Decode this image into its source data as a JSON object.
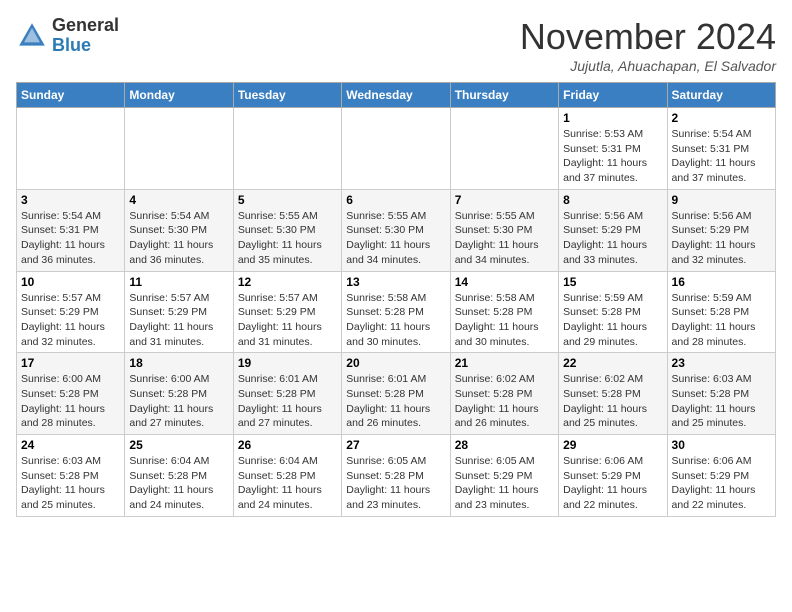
{
  "header": {
    "logo_line1": "General",
    "logo_line2": "Blue",
    "month_title": "November 2024",
    "location": "Jujutla, Ahuachapan, El Salvador"
  },
  "weekdays": [
    "Sunday",
    "Monday",
    "Tuesday",
    "Wednesday",
    "Thursday",
    "Friday",
    "Saturday"
  ],
  "weeks": [
    [
      {
        "day": "",
        "info": ""
      },
      {
        "day": "",
        "info": ""
      },
      {
        "day": "",
        "info": ""
      },
      {
        "day": "",
        "info": ""
      },
      {
        "day": "",
        "info": ""
      },
      {
        "day": "1",
        "info": "Sunrise: 5:53 AM\nSunset: 5:31 PM\nDaylight: 11 hours and 37 minutes."
      },
      {
        "day": "2",
        "info": "Sunrise: 5:54 AM\nSunset: 5:31 PM\nDaylight: 11 hours and 37 minutes."
      }
    ],
    [
      {
        "day": "3",
        "info": "Sunrise: 5:54 AM\nSunset: 5:31 PM\nDaylight: 11 hours and 36 minutes."
      },
      {
        "day": "4",
        "info": "Sunrise: 5:54 AM\nSunset: 5:30 PM\nDaylight: 11 hours and 36 minutes."
      },
      {
        "day": "5",
        "info": "Sunrise: 5:55 AM\nSunset: 5:30 PM\nDaylight: 11 hours and 35 minutes."
      },
      {
        "day": "6",
        "info": "Sunrise: 5:55 AM\nSunset: 5:30 PM\nDaylight: 11 hours and 34 minutes."
      },
      {
        "day": "7",
        "info": "Sunrise: 5:55 AM\nSunset: 5:30 PM\nDaylight: 11 hours and 34 minutes."
      },
      {
        "day": "8",
        "info": "Sunrise: 5:56 AM\nSunset: 5:29 PM\nDaylight: 11 hours and 33 minutes."
      },
      {
        "day": "9",
        "info": "Sunrise: 5:56 AM\nSunset: 5:29 PM\nDaylight: 11 hours and 32 minutes."
      }
    ],
    [
      {
        "day": "10",
        "info": "Sunrise: 5:57 AM\nSunset: 5:29 PM\nDaylight: 11 hours and 32 minutes."
      },
      {
        "day": "11",
        "info": "Sunrise: 5:57 AM\nSunset: 5:29 PM\nDaylight: 11 hours and 31 minutes."
      },
      {
        "day": "12",
        "info": "Sunrise: 5:57 AM\nSunset: 5:29 PM\nDaylight: 11 hours and 31 minutes."
      },
      {
        "day": "13",
        "info": "Sunrise: 5:58 AM\nSunset: 5:28 PM\nDaylight: 11 hours and 30 minutes."
      },
      {
        "day": "14",
        "info": "Sunrise: 5:58 AM\nSunset: 5:28 PM\nDaylight: 11 hours and 30 minutes."
      },
      {
        "day": "15",
        "info": "Sunrise: 5:59 AM\nSunset: 5:28 PM\nDaylight: 11 hours and 29 minutes."
      },
      {
        "day": "16",
        "info": "Sunrise: 5:59 AM\nSunset: 5:28 PM\nDaylight: 11 hours and 28 minutes."
      }
    ],
    [
      {
        "day": "17",
        "info": "Sunrise: 6:00 AM\nSunset: 5:28 PM\nDaylight: 11 hours and 28 minutes."
      },
      {
        "day": "18",
        "info": "Sunrise: 6:00 AM\nSunset: 5:28 PM\nDaylight: 11 hours and 27 minutes."
      },
      {
        "day": "19",
        "info": "Sunrise: 6:01 AM\nSunset: 5:28 PM\nDaylight: 11 hours and 27 minutes."
      },
      {
        "day": "20",
        "info": "Sunrise: 6:01 AM\nSunset: 5:28 PM\nDaylight: 11 hours and 26 minutes."
      },
      {
        "day": "21",
        "info": "Sunrise: 6:02 AM\nSunset: 5:28 PM\nDaylight: 11 hours and 26 minutes."
      },
      {
        "day": "22",
        "info": "Sunrise: 6:02 AM\nSunset: 5:28 PM\nDaylight: 11 hours and 25 minutes."
      },
      {
        "day": "23",
        "info": "Sunrise: 6:03 AM\nSunset: 5:28 PM\nDaylight: 11 hours and 25 minutes."
      }
    ],
    [
      {
        "day": "24",
        "info": "Sunrise: 6:03 AM\nSunset: 5:28 PM\nDaylight: 11 hours and 25 minutes."
      },
      {
        "day": "25",
        "info": "Sunrise: 6:04 AM\nSunset: 5:28 PM\nDaylight: 11 hours and 24 minutes."
      },
      {
        "day": "26",
        "info": "Sunrise: 6:04 AM\nSunset: 5:28 PM\nDaylight: 11 hours and 24 minutes."
      },
      {
        "day": "27",
        "info": "Sunrise: 6:05 AM\nSunset: 5:28 PM\nDaylight: 11 hours and 23 minutes."
      },
      {
        "day": "28",
        "info": "Sunrise: 6:05 AM\nSunset: 5:29 PM\nDaylight: 11 hours and 23 minutes."
      },
      {
        "day": "29",
        "info": "Sunrise: 6:06 AM\nSunset: 5:29 PM\nDaylight: 11 hours and 22 minutes."
      },
      {
        "day": "30",
        "info": "Sunrise: 6:06 AM\nSunset: 5:29 PM\nDaylight: 11 hours and 22 minutes."
      }
    ]
  ]
}
